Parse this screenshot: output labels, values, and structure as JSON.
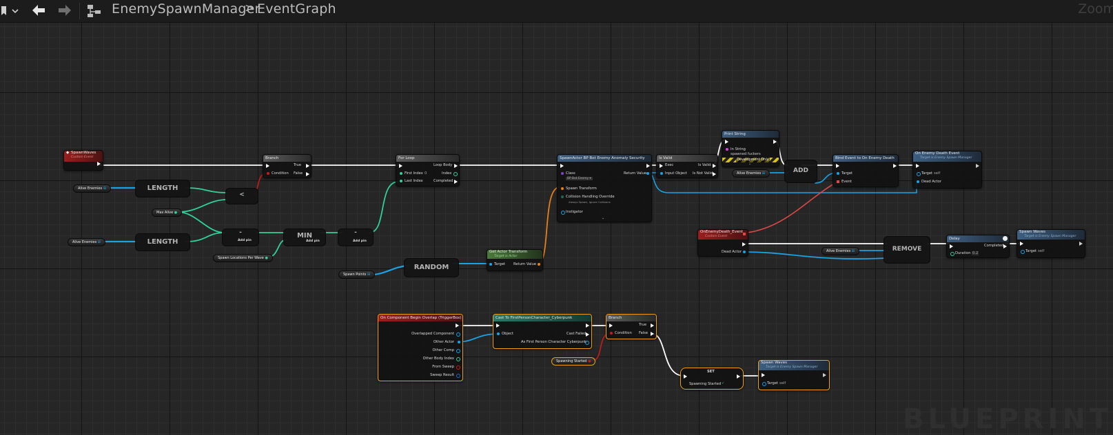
{
  "toolbar": {
    "bookmark_icon": "bookmark-icon",
    "back_icon": "arrow-left-icon",
    "forward_icon": "arrow-right-icon",
    "graph_icon": "graph-hierarchy-icon"
  },
  "breadcrumb": {
    "blueprint": "EnemySpawnManager",
    "separator": ">",
    "graph": "EventGraph"
  },
  "zoom_label": "Zoom",
  "watermark": "BLUEPRINT",
  "nodes": {
    "spawnwaves_event": {
      "title": "SpawnWaves",
      "subtitle": "Custom Event"
    },
    "branch_top": {
      "title": "Branch",
      "condition": "Condition",
      "true": "True",
      "false": "False"
    },
    "for_loop": {
      "title": "For Loop",
      "loop_body": "Loop Body",
      "first_index": "First Index",
      "first_value": "0",
      "index": "Index",
      "last_index": "Last Index",
      "completed": "Completed"
    },
    "spawn_actor": {
      "title": "SpawnActor BP Bot Enemy Anomaly Security",
      "class": "Class",
      "class_value": "BP Bot Enemy ▾",
      "return_value": "Return Value",
      "spawn_transform": "Spawn Transform",
      "collision": "Collision Handling Override",
      "collision_value": "Always Spawn, Ignore Collisions",
      "instigator": "Instigator"
    },
    "is_valid": {
      "title": "Is Valid",
      "exec": "Exec",
      "is_valid": "Is Valid",
      "input_object": "Input Object",
      "is_not_valid": "Is Not Valid"
    },
    "print_string": {
      "title": "Print String",
      "in_string": "In String",
      "in_string_value": "spawned fuckers",
      "dev_only": "Development Only"
    },
    "bind_event": {
      "title": "Bind Event to On Enemy Death",
      "target": "Target",
      "event": "Event"
    },
    "on_enemy_death_call": {
      "title": "On Enemy Death Event",
      "subtitle": "Target is Enemy Spawn Manager",
      "target": "Target",
      "target_value": "self",
      "dead_actor": "Dead Actor"
    },
    "on_enemy_death_custom": {
      "title": "OnEnemyDeath_Event",
      "subtitle": "Custom Event",
      "dead_actor": "Dead Actor"
    },
    "delay": {
      "title": "Delay",
      "completed": "Completed",
      "duration": "Duration",
      "duration_value": "0.2"
    },
    "spawn_waves_call_right": {
      "title": "Spawn Waves",
      "subtitle": "Target is Enemy Spawn Manager",
      "target": "Target",
      "target_value": "self"
    },
    "get_actor_transform": {
      "title": "Get Actor Transform",
      "subtitle": "Target is Actor",
      "target": "Target",
      "return_value": "Return Value"
    },
    "begin_overlap": {
      "title": "On Component Begin Overlap (TriggerBox)",
      "pins": [
        "Overlapped Component",
        "Other Actor",
        "Other Comp",
        "Other Body Index",
        "From Sweep",
        "Sweep Result"
      ]
    },
    "cast": {
      "title": "Cast To FirstPersonCharacter_Cyberpunk",
      "object": "Object",
      "cast_failed": "Cast Failed",
      "as_character": "As First Person Character Cyberpunk"
    },
    "branch_bottom": {
      "title": "Branch",
      "condition": "Condition",
      "true": "True",
      "false": "False"
    },
    "set_node": {
      "title": "SET",
      "spawning_started": "Spawning Started"
    },
    "spawn_waves_call_bottom": {
      "title": "Spawn Waves",
      "subtitle": "Target is Enemy Spawn Manager",
      "target": "Target",
      "target_value": "self"
    }
  },
  "compact_nodes": {
    "length1": "LENGTH",
    "length2": "LENGTH",
    "less": "<",
    "minus": "-",
    "min": "MIN",
    "minus2": "-",
    "random": "RANDOM",
    "add": "ADD",
    "remove": "REMOVE",
    "add_pin": "Add pin"
  },
  "variables": {
    "alive_enemies_1": "Alive Enemies",
    "alive_enemies_2": "Alive Enemies",
    "alive_enemies_3": "Alive Enemies",
    "alive_enemies_4": "Alive Enemies",
    "max_alive": "Max Alive",
    "spawn_locations": "Spawn Locations Per Wave",
    "spawn_points": "Spawn Points",
    "spawning_started": "Spawning Started"
  },
  "colors": {
    "exec": "#ffffff",
    "object": "#1aa2e6",
    "integer": "#2fd39a",
    "bool": "#c71c1c",
    "delegate": "#e04848",
    "transform": "#e8801a",
    "selection": "#f0a018"
  }
}
